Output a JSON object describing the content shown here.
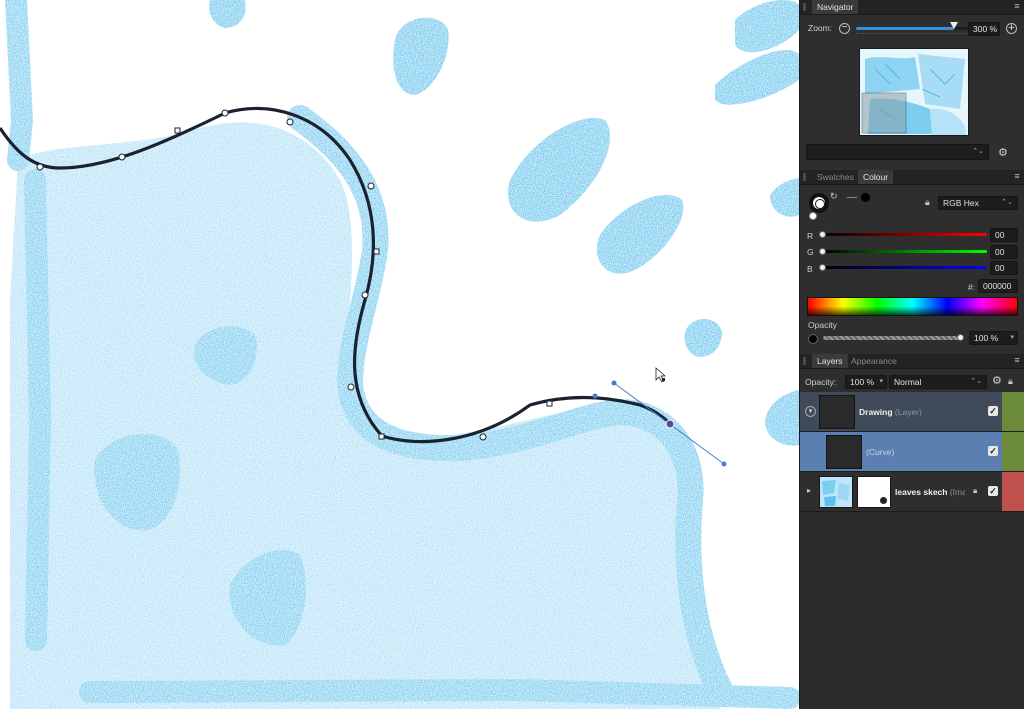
{
  "navigator": {
    "tab_label": "Navigator",
    "zoom_label": "Zoom:",
    "zoom_value": "300 %",
    "zoom_level": 0.83
  },
  "colour": {
    "tabs": [
      "Swatches",
      "Colour"
    ],
    "model": "RGB Hex",
    "r_label": "R",
    "g_label": "G",
    "b_label": "B",
    "r_value": "00",
    "g_value": "00",
    "b_value": "00",
    "hex_label": "#:",
    "hex_value": "000000",
    "opacity_label": "Opacity",
    "opacity_value": "100 %",
    "current_color": "#000000"
  },
  "layers": {
    "tabs": [
      "Layers",
      "Appearance"
    ],
    "opacity_label": "Opacity:",
    "opacity_value": "100 %",
    "blend_mode": "Normal",
    "items": [
      {
        "name": "Drawing",
        "type": "(Layer)",
        "tag_color": "#6b8a3a",
        "checked": "✓"
      },
      {
        "name": "",
        "type": "(Curve)",
        "tag_color": "#6b8a3a",
        "checked": "✓"
      },
      {
        "name": "leaves skech",
        "type": "(Imag",
        "tag_color": "#c0504d",
        "checked": "✓"
      }
    ]
  },
  "icons": {
    "zoom_out": "minus-circle-icon",
    "zoom_in": "plus-circle-icon",
    "gear": "gear-icon",
    "eyedropper": "eyedropper-icon",
    "lock": "lock-icon",
    "menu": "hamburger-menu-icon",
    "cursor": "node-cursor-icon"
  },
  "canvas_colors": {
    "crayon_light": "#9fd8f3",
    "crayon_mid": "#6cc6ee",
    "crayon_dark": "#3fb2e6",
    "curve": "#1a2230",
    "handle": "#4a7bd0"
  }
}
